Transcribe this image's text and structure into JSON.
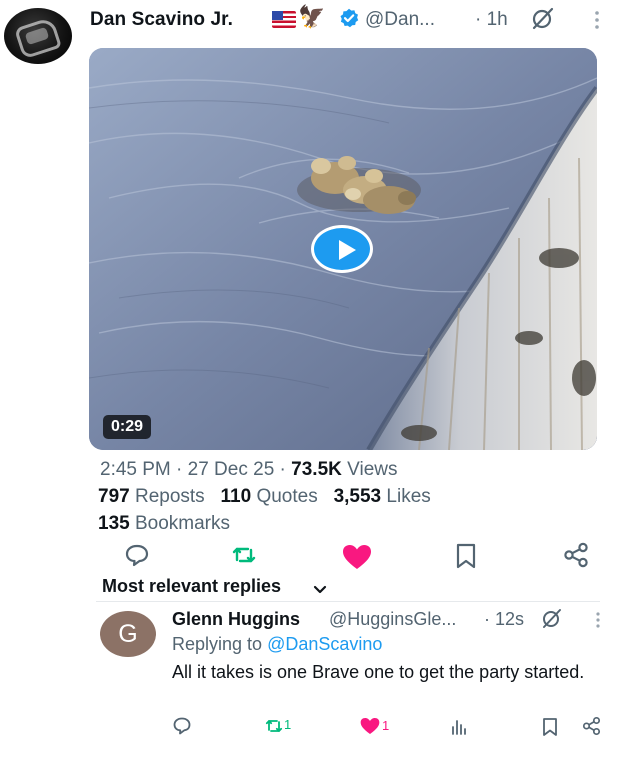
{
  "tweet": {
    "author": "Dan Scavino Jr.",
    "author_emojis": [
      "us-flag",
      "eagle"
    ],
    "handle": "@Dan...",
    "time": "· 1h",
    "video_duration": "0:29",
    "timestamp": "2:45 PM · 27 Dec 25 · ",
    "views_count": "73.5K",
    "views_label": " Views",
    "reposts_count": "797",
    "reposts_label": " Reposts",
    "quotes_count": "110",
    "quotes_label": " Quotes",
    "likes_count": "3,553",
    "likes_label": " Likes",
    "bookmarks_count": "135",
    "bookmarks_label": " Bookmarks",
    "liked": true
  },
  "sort_label": "Most relevant replies",
  "reply": {
    "avatar_letter": "G",
    "name": "Glenn Huggins",
    "handle": "@HugginsGle...",
    "time": "· 12s",
    "replying_prefix": "Replying to ",
    "replying_handle": "@DanScavino",
    "text": "All it takes is one Brave one to get the party started.",
    "repost_count": "1",
    "like_count": "1"
  },
  "colors": {
    "accent": "#1d9bf0",
    "like": "#f91880",
    "repost": "#00ba7c",
    "muted": "#536471",
    "text": "#0f1419"
  },
  "icons": [
    "verified-icon",
    "grok-icon",
    "more-icon",
    "play-icon",
    "reply-icon",
    "repost-icon",
    "heart-icon",
    "bookmark-icon",
    "share-icon",
    "chevron-down-icon",
    "views-icon"
  ]
}
